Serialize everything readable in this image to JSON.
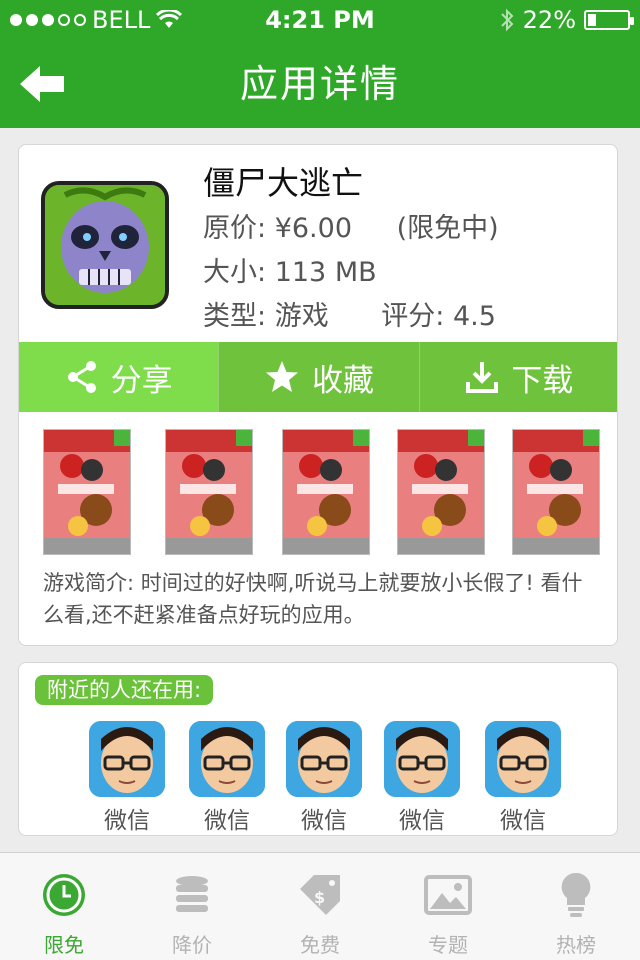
{
  "status_bar": {
    "carrier": "BELL",
    "time": "4:21 PM",
    "battery": "22%",
    "battery_level": 0.22
  },
  "nav": {
    "title": "应用详情",
    "back_icon": "back-arrow-icon"
  },
  "app": {
    "name": "僵尸大逃亡",
    "price_label": "原价:",
    "price": "¥6.00",
    "free_tag": "(限免中)",
    "size_label": "大小:",
    "size": "113 MB",
    "type_label": "类型:",
    "type": "游戏",
    "rating_label": "评分:",
    "rating": "4.5",
    "description": "游戏简介: 时间过的好快啊,听说马上就要放小长假了! 看什么看,还不赶紧准备点好玩的应用。"
  },
  "actions": [
    {
      "label": "分享",
      "icon": "share-icon"
    },
    {
      "label": "收藏",
      "icon": "star-icon"
    },
    {
      "label": "下载",
      "icon": "download-icon"
    }
  ],
  "screenshots_count": 5,
  "nearby": {
    "title": "附近的人还在用:",
    "apps": [
      {
        "label": "微信"
      },
      {
        "label": "微信"
      },
      {
        "label": "微信"
      },
      {
        "label": "微信"
      },
      {
        "label": "微信"
      }
    ]
  },
  "tabs": [
    {
      "label": "限免",
      "icon": "clock-icon",
      "active": true
    },
    {
      "label": "降价",
      "icon": "coins-icon",
      "active": false
    },
    {
      "label": "免费",
      "icon": "price-tag-icon",
      "active": false
    },
    {
      "label": "专题",
      "icon": "picture-icon",
      "active": false
    },
    {
      "label": "热榜",
      "icon": "lightbulb-icon",
      "active": false
    }
  ],
  "colors": {
    "brand_green": "#2fa82a",
    "action_green": "#6fc23b",
    "tab_active": "#3aa832",
    "tab_inactive": "#b3b3b3"
  }
}
